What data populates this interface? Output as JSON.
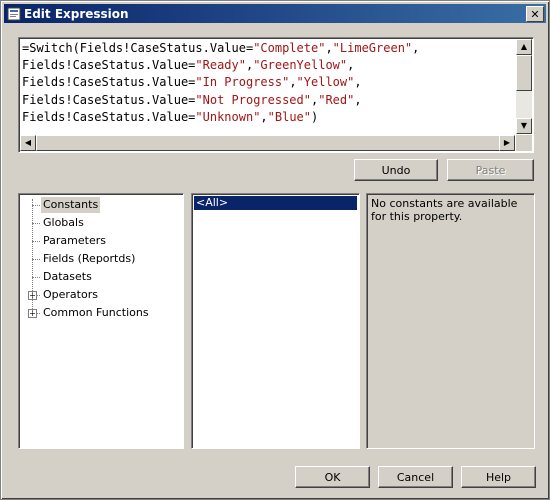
{
  "window": {
    "title": "Edit Expression",
    "close_glyph": "✕"
  },
  "editor": {
    "lines": [
      [
        {
          "t": "=Switch(Fields!CaseStatus.Value=",
          "c": "plain"
        },
        {
          "t": "\"Complete\"",
          "c": "str"
        },
        {
          "t": ",",
          "c": "plain"
        },
        {
          "t": "\"LimeGreen\"",
          "c": "str"
        },
        {
          "t": ",",
          "c": "plain"
        }
      ],
      [
        {
          "t": "Fields!CaseStatus.Value=",
          "c": "plain"
        },
        {
          "t": "\"Ready\"",
          "c": "str"
        },
        {
          "t": ",",
          "c": "plain"
        },
        {
          "t": "\"GreenYellow\"",
          "c": "str"
        },
        {
          "t": ",",
          "c": "plain"
        }
      ],
      [
        {
          "t": "Fields!CaseStatus.Value=",
          "c": "plain"
        },
        {
          "t": "\"In Progress\"",
          "c": "str"
        },
        {
          "t": ",",
          "c": "plain"
        },
        {
          "t": "\"Yellow\"",
          "c": "str"
        },
        {
          "t": ",",
          "c": "plain"
        }
      ],
      [
        {
          "t": "Fields!CaseStatus.Value=",
          "c": "plain"
        },
        {
          "t": "\"Not Progressed\"",
          "c": "str"
        },
        {
          "t": ",",
          "c": "plain"
        },
        {
          "t": "\"Red\"",
          "c": "str"
        },
        {
          "t": ",",
          "c": "plain"
        }
      ],
      [
        {
          "t": "Fields!CaseStatus.Value=",
          "c": "plain"
        },
        {
          "t": "\"Unknown\"",
          "c": "str"
        },
        {
          "t": ",",
          "c": "plain"
        },
        {
          "t": "\"Blue\"",
          "c": "str"
        },
        {
          "t": ")",
          "c": "plain"
        }
      ]
    ],
    "string_color": "#a31515"
  },
  "edit_buttons": {
    "undo": "Undo",
    "paste": "Paste"
  },
  "tree": {
    "items": [
      {
        "label": "Constants",
        "expandable": false,
        "selected": true
      },
      {
        "label": "Globals",
        "expandable": false,
        "selected": false
      },
      {
        "label": "Parameters",
        "expandable": false,
        "selected": false
      },
      {
        "label": "Fields (Reportds)",
        "expandable": false,
        "selected": false
      },
      {
        "label": "Datasets",
        "expandable": false,
        "selected": false
      },
      {
        "label": "Operators",
        "expandable": true,
        "selected": false
      },
      {
        "label": "Common Functions",
        "expandable": true,
        "selected": false
      }
    ]
  },
  "list": {
    "items": [
      {
        "label": "<All>",
        "selected": true
      }
    ]
  },
  "description": "No constants are available for this property.",
  "footer": {
    "ok": "OK",
    "cancel": "Cancel",
    "help": "Help"
  },
  "colors": {
    "titlebar_start": "#0a246a",
    "titlebar_end": "#3a6ea5",
    "face": "#d4d0c8",
    "selection": "#0a246a"
  }
}
